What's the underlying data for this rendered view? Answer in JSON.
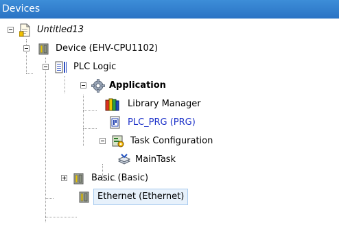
{
  "panel": {
    "title": "Devices"
  },
  "tree": {
    "untitled": "Untitled13",
    "device": "Device (EHV-CPU1102)",
    "plc_logic": "PLC Logic",
    "application": "Application",
    "library_manager": "Library Manager",
    "plc_prg": "PLC_PRG (PRG)",
    "task_configuration": "Task Configuration",
    "main_task": "MainTask",
    "basic": "Basic (Basic)",
    "ethernet": "Ethernet (Ethernet)"
  },
  "colors": {
    "header_bg": "#2a73c4",
    "link_text": "#1a2fc8",
    "selection_bg": "#e7f1fb",
    "selection_border": "#a9cbef"
  },
  "icons": [
    "project-icon",
    "device-icon",
    "plc-logic-icon",
    "application-gear-icon",
    "library-books-icon",
    "pou-program-icon",
    "task-config-icon",
    "main-task-icon",
    "device-icon",
    "device-icon"
  ]
}
